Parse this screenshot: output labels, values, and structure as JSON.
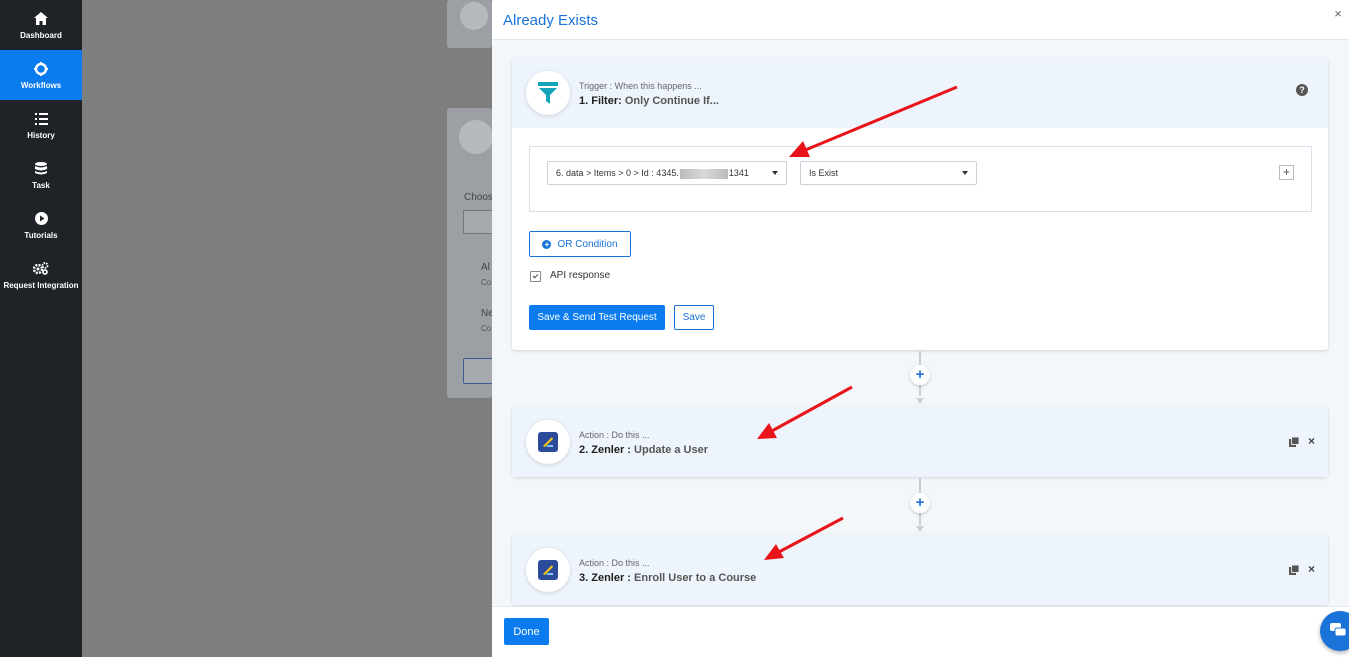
{
  "sidebar": {
    "items": [
      {
        "label": "Dashboard",
        "icon": "home-icon",
        "active": false
      },
      {
        "label": "Workflows",
        "icon": "workflow-icon",
        "active": true
      },
      {
        "label": "History",
        "icon": "history-list-icon",
        "active": false
      },
      {
        "label": "Task",
        "icon": "database-icon",
        "active": false
      },
      {
        "label": "Tutorials",
        "icon": "play-circle-icon",
        "active": false
      },
      {
        "label": "Request Integration",
        "icon": "gears-icon",
        "active": false
      }
    ]
  },
  "background": {
    "fragments": [
      "Choos",
      "Al",
      "Co",
      "Ne",
      "Co"
    ]
  },
  "modal": {
    "title": "Already Exists",
    "close": "×",
    "step1": {
      "sub": "Trigger : When this happens ...",
      "title_bold": "1. Filter:",
      "title_rest": "Only Continue If...",
      "help": "?",
      "field_select_prefix": "6. data > Items > 0 > Id : 4345.",
      "field_select_suffix": "1341",
      "operator_select": "Is Exist",
      "add": "+",
      "or_condition": "OR Condition",
      "api_response": "API response",
      "save_send": "Save & Send Test Request",
      "save": "Save"
    },
    "connector_plus": "+",
    "step2": {
      "sub": "Action : Do this ...",
      "title_bold": "2. Zenler :",
      "title_rest": "Update a User"
    },
    "step3": {
      "sub": "Action : Do this ...",
      "title_bold": "3. Zenler :",
      "title_rest": "Enroll User to a Course"
    },
    "done": "Done"
  },
  "colors": {
    "accent": "#0a7cf0",
    "sidebar_bg": "#1f2328",
    "annotation_arrow": "#e8141a",
    "filter_icon": "#14a3b8",
    "zenler_brand": "#2b4a9a"
  }
}
